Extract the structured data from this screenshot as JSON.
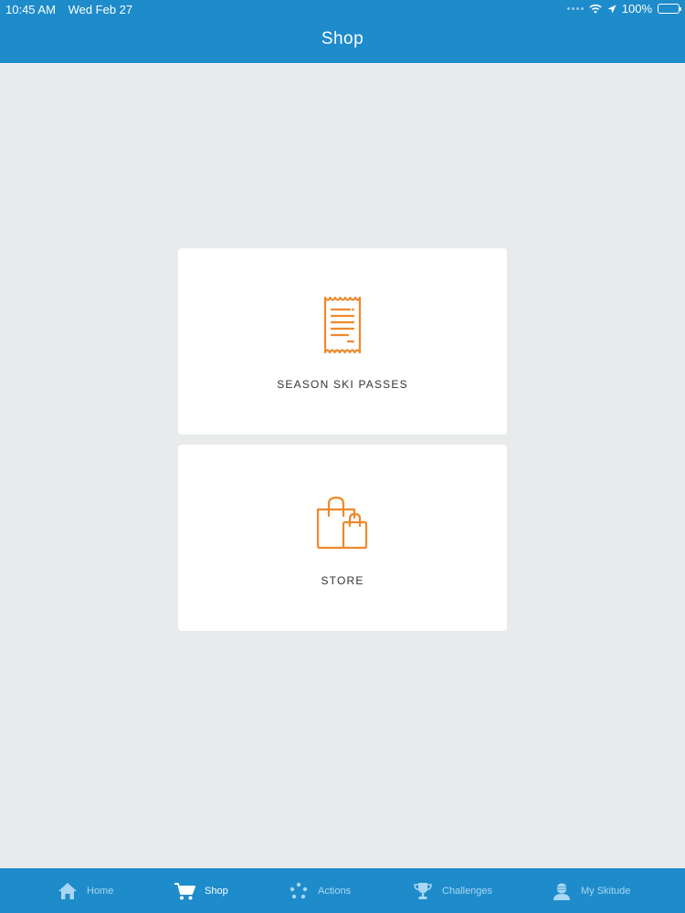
{
  "status_bar": {
    "time": "10:45 AM",
    "date": "Wed Feb 27",
    "battery": "100%",
    "battery_level": 1.0
  },
  "header": {
    "title": "Shop"
  },
  "cards": {
    "season_passes": {
      "label": "SEASON SKI PASSES",
      "icon": "receipt-icon"
    },
    "store": {
      "label": "STORE",
      "icon": "shopping-bags-icon"
    }
  },
  "tabbar": {
    "items": [
      {
        "label": "Home",
        "icon": "home-icon",
        "active": false
      },
      {
        "label": "Shop",
        "icon": "cart-icon",
        "active": true
      },
      {
        "label": "Actions",
        "icon": "dots-icon",
        "active": false
      },
      {
        "label": "Challenges",
        "icon": "trophy-icon",
        "active": false
      },
      {
        "label": "My Skitude",
        "icon": "skier-avatar-icon",
        "active": false
      }
    ]
  },
  "colors": {
    "header": "#1e8bcb",
    "accent_orange": "#f0882b",
    "background": "#e8eaeb",
    "tab_inactive": "#a9d6f3",
    "tab_active": "#ffffff"
  }
}
